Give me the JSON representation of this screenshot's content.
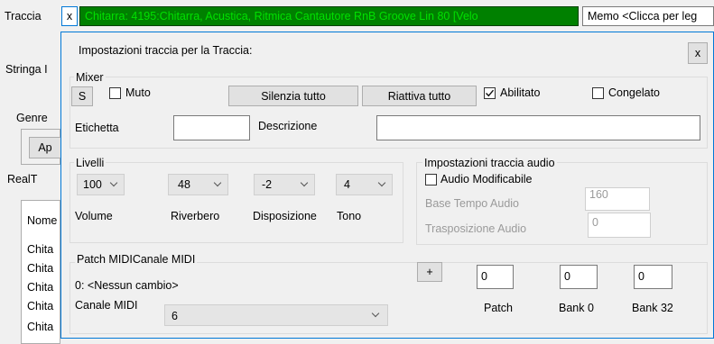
{
  "background": {
    "track_label": "Traccia",
    "close_x": "x",
    "track_name": "Chitarra: 4195:Chitarra, Acustica, Ritmica Cantautore RnB Groove Lin 80 [Velo",
    "memo": "Memo  <Clicca per leg",
    "stringa": "Stringa I",
    "genre": "Genre",
    "ap_button": "Ap",
    "realt": "RealT",
    "list_header": "Nome",
    "list_items": [
      "Chita",
      "Chita",
      "Chita",
      "Chita",
      "Chita"
    ]
  },
  "dialog": {
    "title": "Impostazioni traccia per la Traccia:",
    "close": "x"
  },
  "mixer": {
    "group_label": "Mixer",
    "solo": "S",
    "mute_label": "Muto",
    "mute_all": "Silenzia tutto",
    "unmute_all": "Riattiva tutto",
    "enabled_label": "Abilitato",
    "enabled_checked": true,
    "frozen_label": "Congelato",
    "frozen_checked": false,
    "label_caption": "Etichetta",
    "label_value": "",
    "description_caption": "Descrizione",
    "description_value": ""
  },
  "levels": {
    "group_label": "Livelli",
    "volume": "100",
    "volume_label": "Volume",
    "reverb": "48",
    "reverb_label": "Riverbero",
    "pan": "-2",
    "pan_label": "Disposizione",
    "tone": "4",
    "tone_label": "Tono"
  },
  "audio": {
    "group_label": "Impostazioni traccia audio",
    "editable_label": "Audio Modificabile",
    "editable_checked": false,
    "tempo_label": "Base Tempo Audio",
    "tempo_value": "160",
    "transpose_label": "Trasposizione Audio",
    "transpose_value": "0"
  },
  "patch": {
    "group_label": "Patch MIDICanale MIDI",
    "current": "0: <Nessun cambio>",
    "plus": "+",
    "channel_label": "Canale MIDI",
    "channel_value": "6",
    "patch_value": "0",
    "patch_label": "Patch",
    "bank0_value": "0",
    "bank0_label": "Bank 0",
    "bank32_value": "0",
    "bank32_label": "Bank 32"
  },
  "colors": {
    "track_bg": "#008000",
    "track_text": "#00e000",
    "accent_blue": "#0078d7"
  }
}
